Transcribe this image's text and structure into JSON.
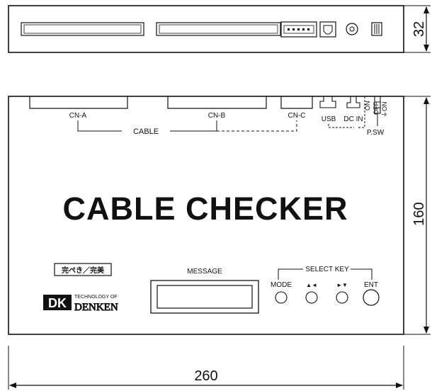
{
  "dimensions": {
    "top_height": "32",
    "front_height": "160",
    "width": "260"
  },
  "connectors": {
    "cn_a": "CN-A",
    "cn_b": "CN-B",
    "cn_c": "CN-C",
    "usb": "USB",
    "dc_in": "DC IN",
    "cable": "CABLE",
    "power_switch": "P.SW",
    "switch_on": "ON",
    "switch_off": "OFF",
    "switch_ground_on": "⏚ON"
  },
  "product": {
    "title": "CABLE CHECKER",
    "slogan": "完ぺき／完美"
  },
  "logo": {
    "mark": "DK",
    "tagline": "TECHNOLOGY OF",
    "name": "DENKEN"
  },
  "display": {
    "message_label": "MESSAGE"
  },
  "keys": {
    "group_label": "SELECT KEY",
    "mode": "MODE",
    "left": "▲◄",
    "right": "►▼",
    "ent": "ENT"
  }
}
